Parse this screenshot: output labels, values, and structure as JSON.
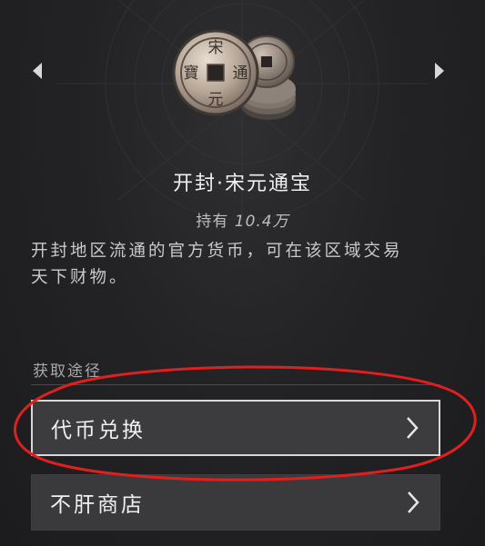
{
  "item": {
    "name": "开封·宋元通宝",
    "holding_prefix": "持有",
    "holding_value": "10.4万",
    "description_line1": "开封地区流通的官方货币，可在该区域交易",
    "description_line2": "天下财物。"
  },
  "coin": {
    "char_top": "宋",
    "char_right": "通",
    "char_bottom": "元",
    "char_left": "寶"
  },
  "acquire": {
    "section_label": "获取途径",
    "options": [
      {
        "label": "代币兑换"
      },
      {
        "label": "不肝商店"
      }
    ]
  },
  "icons": {
    "prev": "triangle-left-icon",
    "next": "triangle-right-icon",
    "option_chevron": "chevron-right-icon"
  },
  "colors": {
    "background": "#232325",
    "button": "#3a3a3c",
    "highlight_border": "#d8d8d8",
    "annotation_red": "#e11f1f"
  }
}
